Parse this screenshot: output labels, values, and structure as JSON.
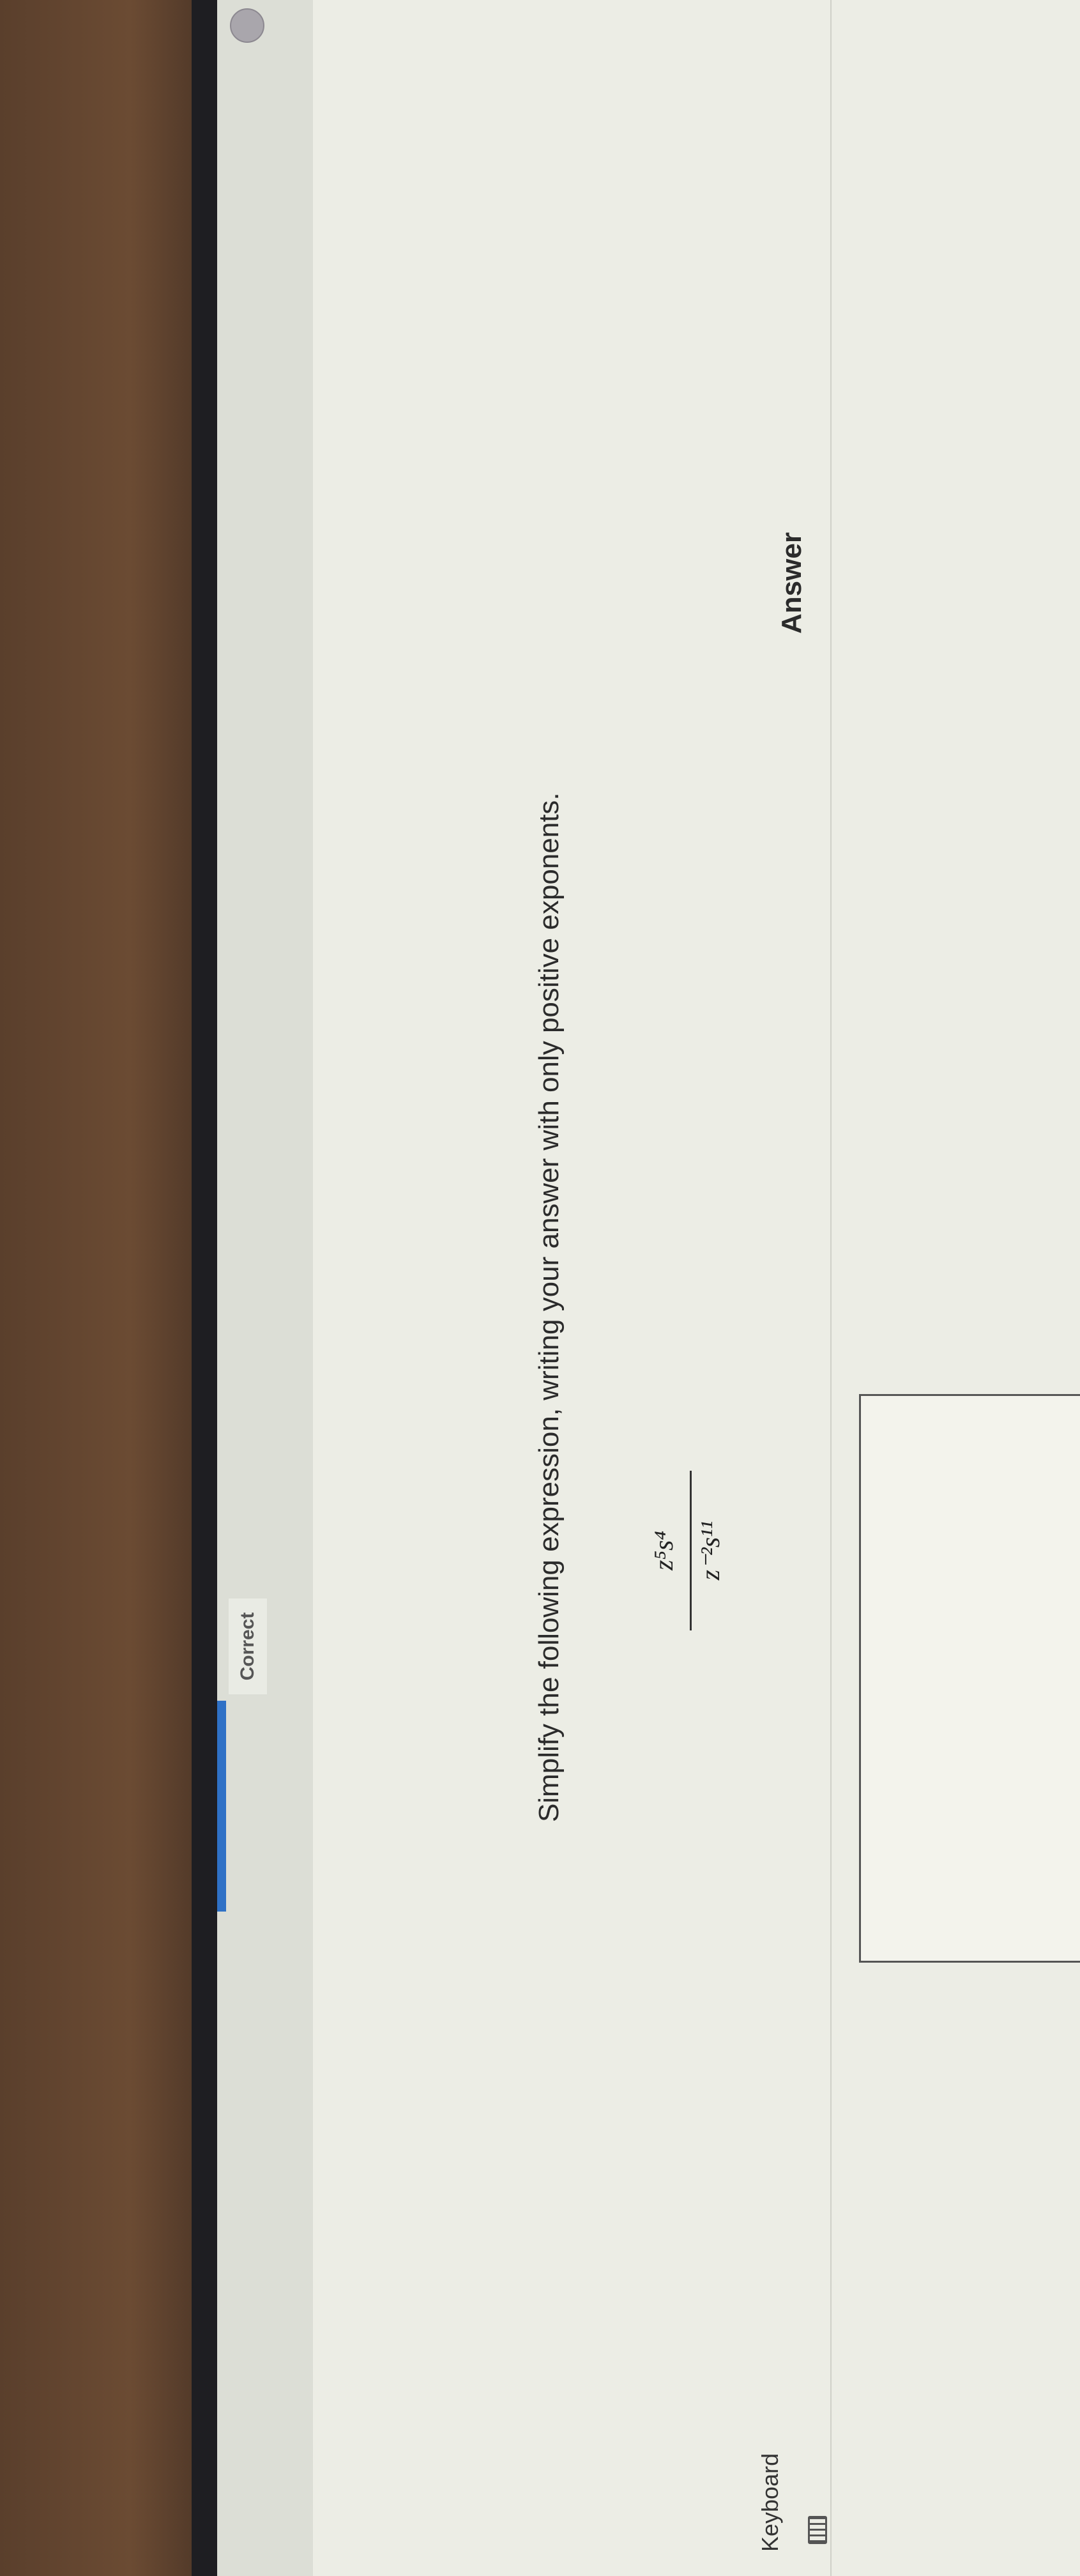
{
  "header": {
    "status_badge": "Correct"
  },
  "question": {
    "prompt": "Simplify the following expression, writing your answer with only positive exponents.",
    "expression": {
      "numerator": "z⁵s⁴",
      "denominator": "z⁻²s¹¹"
    }
  },
  "answer": {
    "label": "Answer",
    "value": ""
  },
  "keyboard": {
    "label": "Keyboard"
  },
  "colors": {
    "accent": "#2f71c6",
    "page_bg": "#ecede5"
  }
}
